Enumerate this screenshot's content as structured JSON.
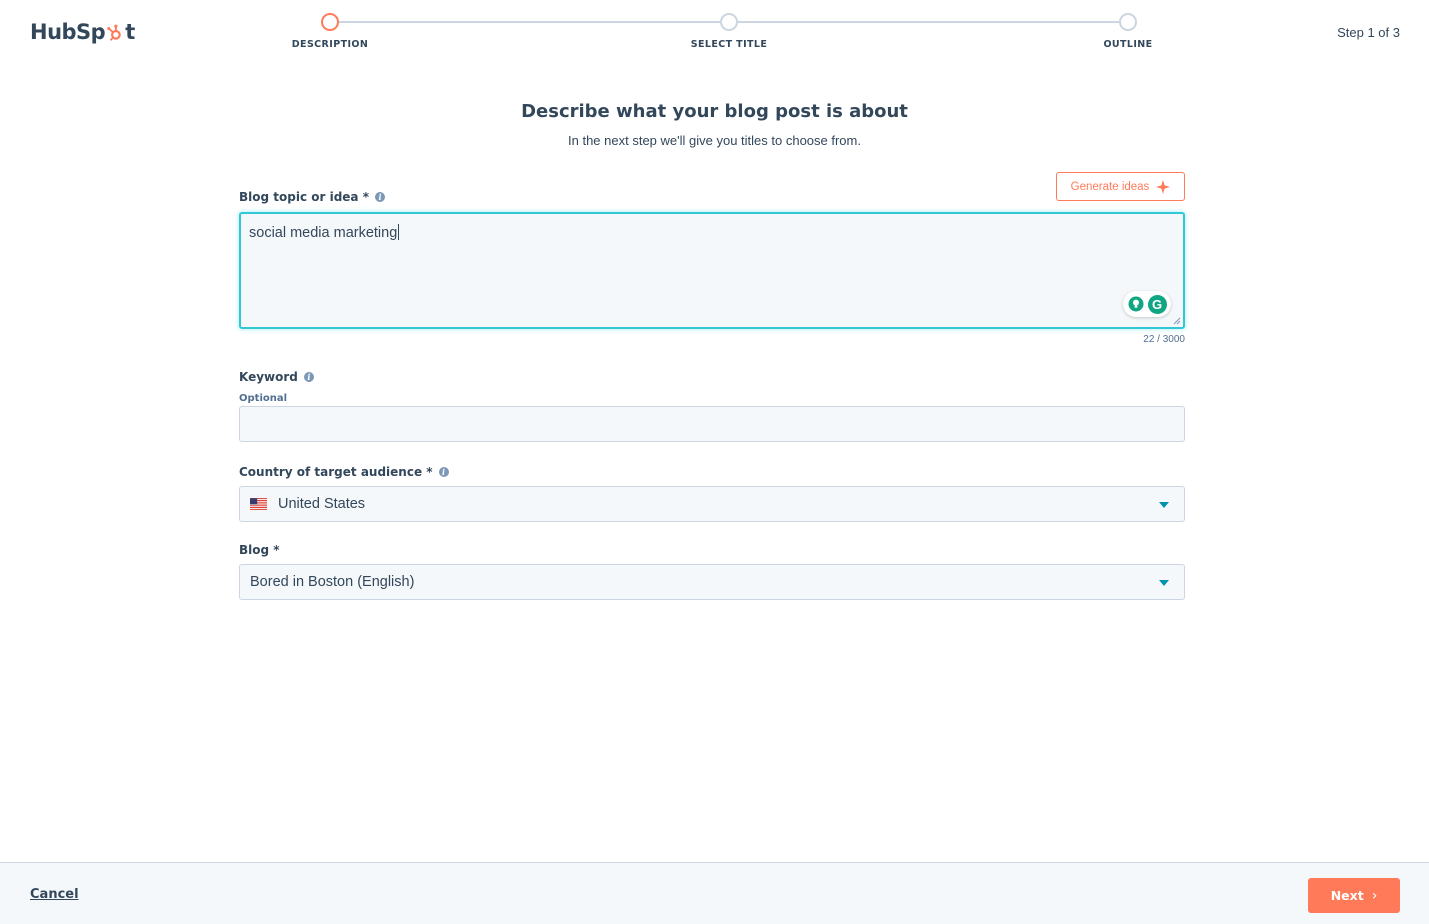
{
  "logo": {
    "text_before": "HubSp",
    "text_after": "t"
  },
  "stepper": {
    "steps": [
      {
        "label": "DESCRIPTION",
        "active": true
      },
      {
        "label": "SELECT TITLE",
        "active": false
      },
      {
        "label": "OUTLINE",
        "active": false
      }
    ],
    "count": "Step 1 of 3"
  },
  "main": {
    "title": "Describe what your blog post is about",
    "subtitle": "In the next step we'll give you titles to choose from."
  },
  "form": {
    "generate_ideas_label": "Generate ideas",
    "topic": {
      "label": "Blog topic or idea *",
      "value": "social media marketing",
      "char_count": "22 / 3000"
    },
    "keyword": {
      "label": "Keyword",
      "optional": "Optional",
      "value": ""
    },
    "country": {
      "label": "Country of target audience *",
      "value": "United States",
      "flag_icon": "us-flag-icon"
    },
    "blog": {
      "label": "Blog *",
      "value": "Bored in Boston (English)"
    }
  },
  "footer": {
    "cancel_label": "Cancel",
    "next_label": "Next",
    "next_icon": "›"
  },
  "colors": {
    "accent": "#ff7a59",
    "text": "#33475b",
    "focus": "#32c7d4",
    "caret": "#0091ae",
    "input_bg": "#f5f8fa"
  }
}
